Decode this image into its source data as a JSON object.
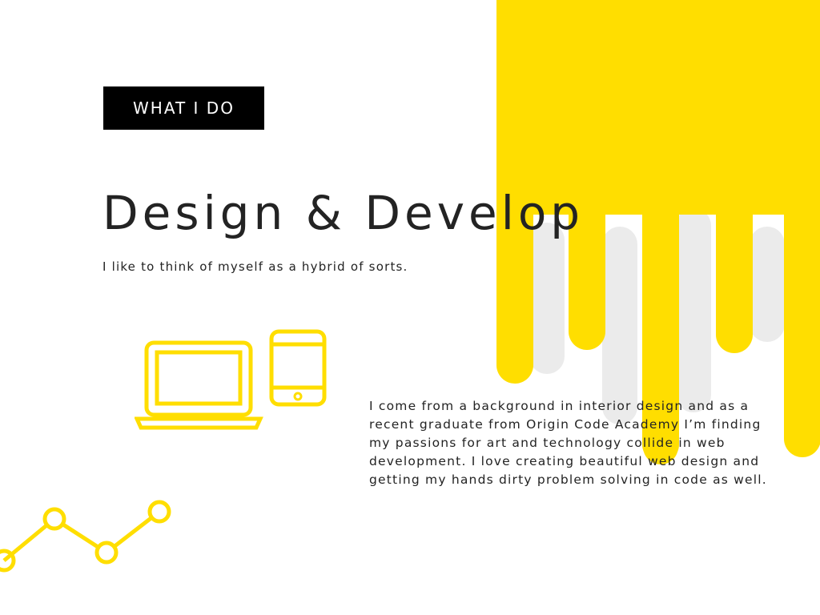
{
  "section": {
    "badge": "WHAT I DO"
  },
  "hero": {
    "title": "Design & Develop",
    "tagline": "I like to think of myself as a hybrid of sorts."
  },
  "about": {
    "body": "I come from a background in interior design and as a recent graduate from Origin Code Academy I’m finding my passions for art and technology collide in web development. I love creating beautiful web design and getting my hands dirty problem solving in code as well."
  },
  "icons": {
    "devices": "laptop-tablet-icon",
    "graph": "line-graph-icon",
    "decor": "yellow-drip-decoration"
  },
  "colors": {
    "accent": "#FFDE00",
    "drip_shadow": "#EBEBEB",
    "badge_background": "#000000",
    "badge_text": "#FFFFFF",
    "text": "#232323",
    "background": "#FFFFFF"
  }
}
